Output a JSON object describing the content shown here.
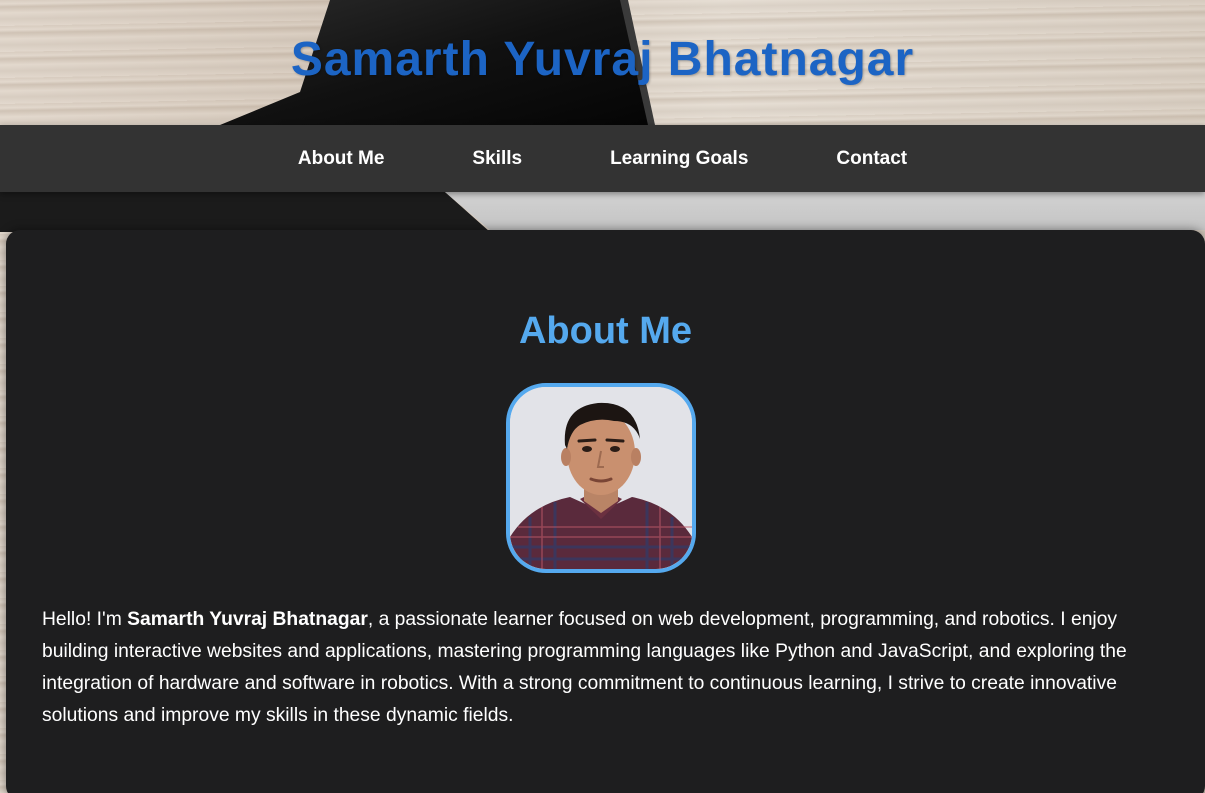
{
  "header": {
    "title": "Samarth Yuvraj Bhatnagar"
  },
  "nav": {
    "items": [
      {
        "label": "About Me"
      },
      {
        "label": "Skills"
      },
      {
        "label": "Learning Goals"
      },
      {
        "label": "Contact"
      }
    ]
  },
  "about": {
    "heading": "About Me",
    "avatar_icon": "profile-photo",
    "bio_prefix": "Hello! I'm ",
    "bio_name": "Samarth Yuvraj Bhatnagar",
    "bio_rest": ", a passionate learner focused on web development, programming, and robotics. I enjoy building interactive websites and applications, mastering programming languages like Python and JavaScript, and exploring the integration of hardware and software in robotics. With a strong commitment to continuous learning, I strive to create innovative solutions and improve my skills in these dynamic fields."
  },
  "colors": {
    "title": "#1c64c4",
    "accent": "#55a9ee",
    "nav_bg": "#333333",
    "card_bg": "#1e1e1f"
  }
}
